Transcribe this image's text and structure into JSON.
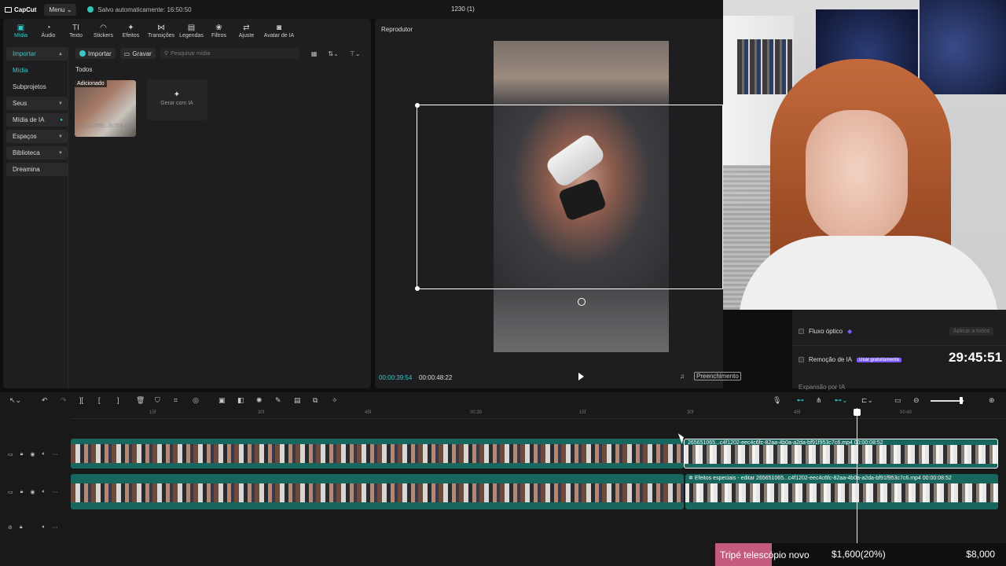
{
  "app": {
    "logo": "CapCut",
    "menu_label": "Menu",
    "save_status": "Salvo automaticamente: 16:50:50",
    "project_title": "1230 (1)"
  },
  "toolbar": {
    "tools": [
      {
        "label": "Mídia",
        "icon": "media-icon",
        "glyph": "▣"
      },
      {
        "label": "Áudio",
        "icon": "audio-icon",
        "glyph": "◔"
      },
      {
        "label": "Texto",
        "icon": "text-icon",
        "glyph": "TI"
      },
      {
        "label": "Stickers",
        "icon": "sticker-icon",
        "glyph": "◠"
      },
      {
        "label": "Efeitos",
        "icon": "effects-icon",
        "glyph": "✦"
      },
      {
        "label": "Transições",
        "icon": "transitions-icon",
        "glyph": "⋈"
      },
      {
        "label": "Legendas",
        "icon": "captions-icon",
        "glyph": "▤"
      },
      {
        "label": "Filtros",
        "icon": "filters-icon",
        "glyph": "❀"
      },
      {
        "label": "Ajuste",
        "icon": "adjust-icon",
        "glyph": "⇄"
      },
      {
        "label": "Avatar de IA",
        "icon": "avatar-icon",
        "glyph": "◙"
      }
    ]
  },
  "sidenav": {
    "items": [
      {
        "label": "Importar"
      },
      {
        "label": "Mídia"
      },
      {
        "label": "Subprojetos"
      },
      {
        "label": "Seus"
      },
      {
        "label": "Mídia de IA"
      },
      {
        "label": "Espaços"
      },
      {
        "label": "Biblioteca"
      },
      {
        "label": "Dreamina"
      }
    ]
  },
  "media": {
    "import_label": "Importar",
    "record_label": "Gravar",
    "search_placeholder": "Pesquisar mídia",
    "section_label": "Todos",
    "clip_badge": "Adicionado",
    "clip_name": "2656510​65...3c7c6.mp4",
    "generate_label": "Gerar com IA"
  },
  "player": {
    "title": "Reprodutor",
    "current_time": "00:00:39:54",
    "total_time": "00:00:48:22",
    "fill_label": "Preenchimento",
    "ratio": "9:16"
  },
  "inspector": {
    "optical_flow": "Fluxo óptico",
    "apply_label": "Aplicar a todos",
    "ai_removal": "Remoção de IA",
    "ai_removal_tag": "Usar gratuitamente",
    "ai_expand": "Expansão por IA"
  },
  "overlay_clock": "29:45:51",
  "timeline": {
    "ruler_ticks": [
      "15f",
      "30f",
      "45f",
      "00:39",
      "15f",
      "30f",
      "45f",
      "00:40"
    ],
    "clip1_label": "2656510​65...c4f1202-eec4c6fc-82aa-4b0a-a2da-bf91f953c7c6.mp4   00:00:08:52",
    "clip2_effect": "Efeitos especiais - editar",
    "clip2_label": "2656510​65...c4f1202-eec4c6fc-82aa-4b0a-a2da-bf91f953c7c6.mp4   00:00:08:52"
  },
  "goal": {
    "label": "Tripé telescópio novo",
    "progress": "$1,600(20%)",
    "target": "$8,000"
  },
  "colors": {
    "accent": "#3cc7c7",
    "goal_bar": "#c35b7e",
    "clip_teal": "#17675f",
    "ai_tag": "#7d5cff"
  }
}
